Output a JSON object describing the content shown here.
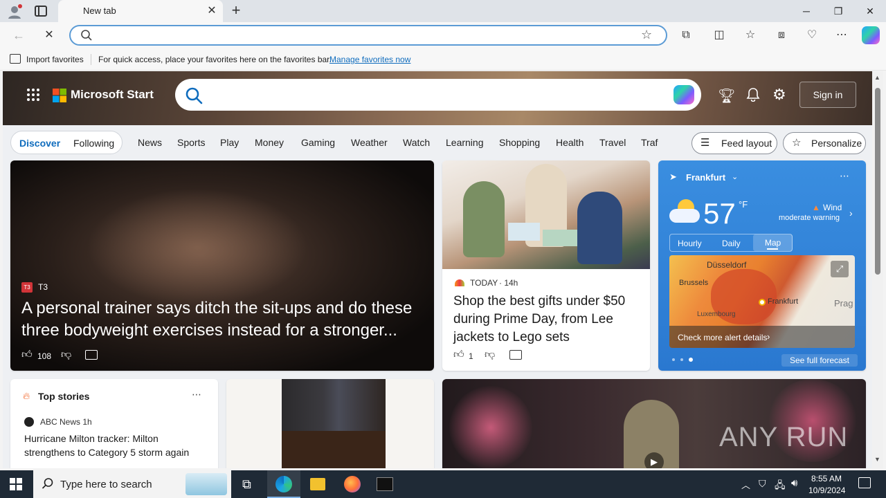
{
  "browser": {
    "tab_title": "New tab",
    "address_value": "",
    "favorites_bar": {
      "import_label": "Import favorites",
      "hint": "For quick access, place your favorites here on the favorites bar.",
      "manage_link": "Manage favorites now"
    }
  },
  "msn": {
    "brand": "Microsoft Start",
    "sign_in": "Sign in",
    "segment": [
      "Discover",
      "Following"
    ],
    "nav": [
      "News",
      "Sports",
      "Play",
      "Money",
      "Gaming",
      "Weather",
      "Watch",
      "Learning",
      "Shopping",
      "Health",
      "Travel",
      "Traf"
    ],
    "feed_layout": "Feed layout",
    "personalize": "Personalize",
    "hero_article": {
      "source": "T3",
      "source_badge": "T3",
      "title": "A personal trainer says ditch the sit-ups and do these three bodyweight exercises instead for a stronger...",
      "likes": "108"
    },
    "gift_article": {
      "source": "TODAY",
      "age": "· 14h",
      "title": "Shop the best gifts under $50 during Prime Day, from Lee jackets to Lego sets",
      "likes": "1"
    },
    "weather": {
      "city": "Frankfurt",
      "temp": "57",
      "unit": "°F",
      "alert_title": "Wind",
      "alert_sub": "moderate warning",
      "tabs": [
        "Hourly",
        "Daily",
        "Map"
      ],
      "active_tab": "Map",
      "map_labels": [
        "Düsseldorf",
        "Brussels",
        "Frankfurt",
        "Luxembourg",
        "Prag"
      ],
      "alert_link": "Check more alert details",
      "forecast_link": "See full forecast"
    },
    "top_stories": {
      "heading": "Top stories",
      "source": "ABC News",
      "age": "· 1h",
      "title": "Hurricane Milton tracker: Milton strengthens to Category 5 storm again"
    },
    "watermark": "ANY RUN"
  },
  "taskbar": {
    "search_placeholder": "Type here to search",
    "time": "8:55 AM",
    "date": "10/9/2024"
  },
  "colors": {
    "accent": "#0f6cbd",
    "weather_card": "#2f7fd8",
    "taskbar": "#1f2a36"
  }
}
